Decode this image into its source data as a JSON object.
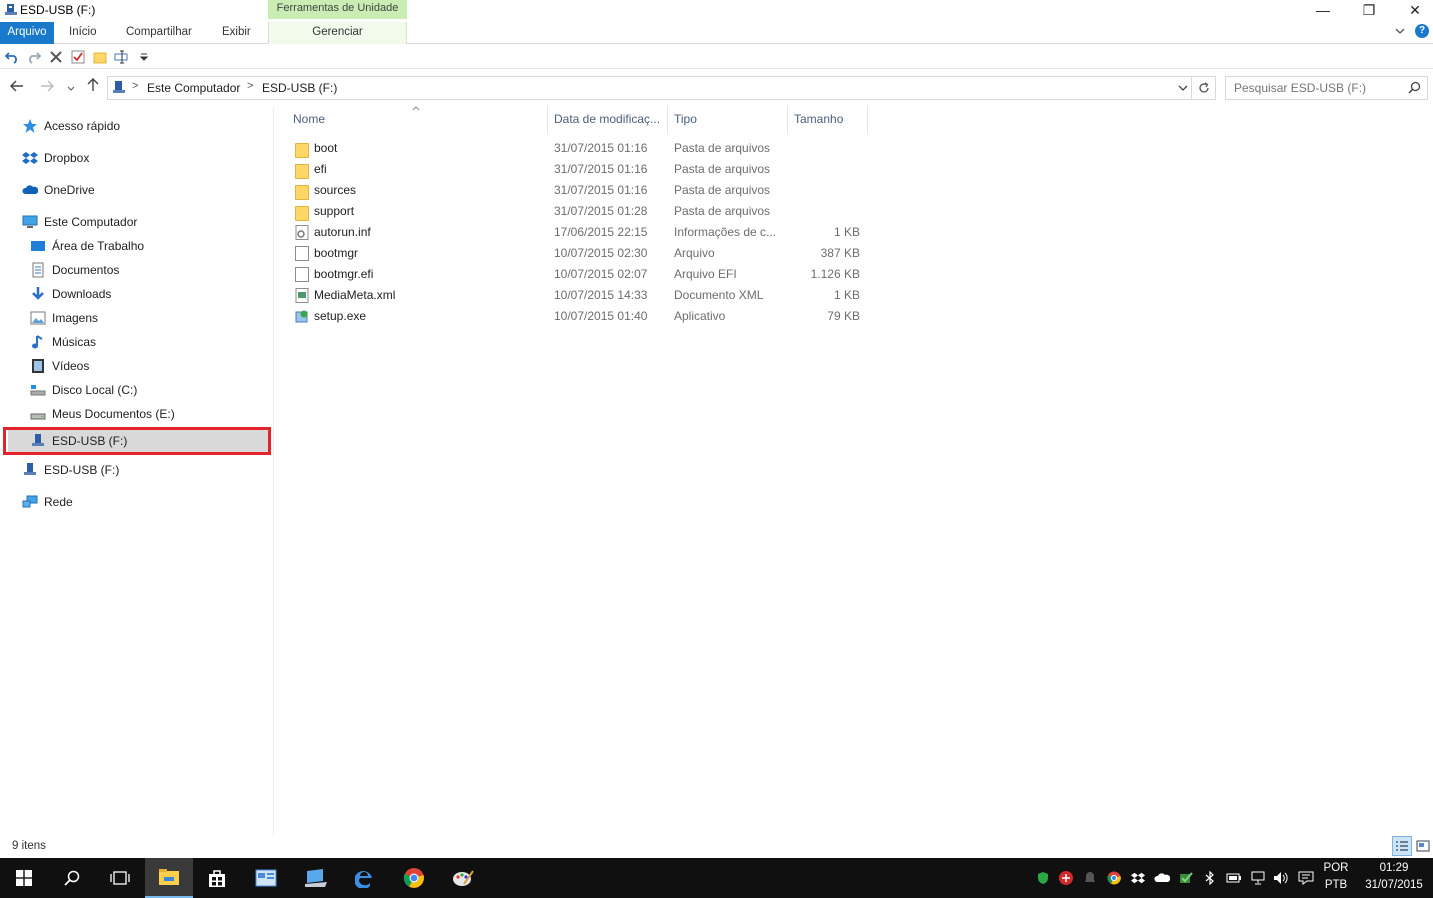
{
  "window": {
    "title": "ESD-USB (F:)",
    "minimize": "—",
    "maximize": "❐",
    "close": "✕"
  },
  "ribbon": {
    "context_group": "Ferramentas de Unidade",
    "tabs": [
      {
        "label": "Arquivo"
      },
      {
        "label": "Início"
      },
      {
        "label": "Compartilhar"
      },
      {
        "label": "Exibir"
      },
      {
        "label": "Gerenciar"
      }
    ],
    "expand_icon": "chevron-down-icon",
    "help": "?"
  },
  "address_bar": {
    "crumbs": [
      "Este Computador",
      "ESD-USB (F:)"
    ],
    "separator": ">"
  },
  "search": {
    "placeholder": "Pesquisar ESD-USB (F:)"
  },
  "nav_pane": {
    "items": [
      {
        "label": "Acesso rápido",
        "icon": "star-icon"
      },
      {
        "label": "Dropbox",
        "icon": "dropbox-icon"
      },
      {
        "label": "OneDrive",
        "icon": "cloud-icon"
      },
      {
        "label": "Este Computador",
        "icon": "computer-icon"
      },
      {
        "label": "Área de Trabalho",
        "icon": "desktop-icon"
      },
      {
        "label": "Documentos",
        "icon": "documents-icon"
      },
      {
        "label": "Downloads",
        "icon": "download-icon"
      },
      {
        "label": "Imagens",
        "icon": "pictures-icon"
      },
      {
        "label": "Músicas",
        "icon": "music-icon"
      },
      {
        "label": "Vídeos",
        "icon": "video-icon"
      },
      {
        "label": "Disco Local (C:)",
        "icon": "drive-icon"
      },
      {
        "label": "Meus Documentos (E:)",
        "icon": "drive-icon"
      },
      {
        "label": "ESD-USB (F:)",
        "icon": "usb-drive-icon",
        "selected": true
      },
      {
        "label": "ESD-USB (F:)",
        "icon": "usb-drive-icon"
      },
      {
        "label": "Rede",
        "icon": "network-icon"
      }
    ]
  },
  "file_list": {
    "columns": [
      "Nome",
      "Data de modificaç...",
      "Tipo",
      "Tamanho"
    ],
    "rows": [
      {
        "name": "boot",
        "date": "31/07/2015 01:16",
        "type": "Pasta de arquivos",
        "size": "",
        "icon": "folder-icon"
      },
      {
        "name": "efi",
        "date": "31/07/2015 01:16",
        "type": "Pasta de arquivos",
        "size": "",
        "icon": "folder-icon"
      },
      {
        "name": "sources",
        "date": "31/07/2015 01:16",
        "type": "Pasta de arquivos",
        "size": "",
        "icon": "folder-icon"
      },
      {
        "name": "support",
        "date": "31/07/2015 01:28",
        "type": "Pasta de arquivos",
        "size": "",
        "icon": "folder-icon"
      },
      {
        "name": "autorun.inf",
        "date": "17/06/2015 22:15",
        "type": "Informações de c...",
        "size": "1 KB",
        "icon": "settings-file-icon"
      },
      {
        "name": "bootmgr",
        "date": "10/07/2015 02:30",
        "type": "Arquivo",
        "size": "387 KB",
        "icon": "file-icon"
      },
      {
        "name": "bootmgr.efi",
        "date": "10/07/2015 02:07",
        "type": "Arquivo EFI",
        "size": "1.126 KB",
        "icon": "file-icon"
      },
      {
        "name": "MediaMeta.xml",
        "date": "10/07/2015 14:33",
        "type": "Documento XML",
        "size": "1 KB",
        "icon": "xml-file-icon"
      },
      {
        "name": "setup.exe",
        "date": "10/07/2015 01:40",
        "type": "Aplicativo",
        "size": "79 KB",
        "icon": "setup-icon"
      }
    ]
  },
  "status_bar": {
    "item_count": "9 itens"
  },
  "taskbar": {
    "language": "POR",
    "layout": "PTB",
    "time": "01:29",
    "date": "31/07/2015",
    "colors": {
      "background": "#101010",
      "accent": "#76b9ed"
    }
  }
}
